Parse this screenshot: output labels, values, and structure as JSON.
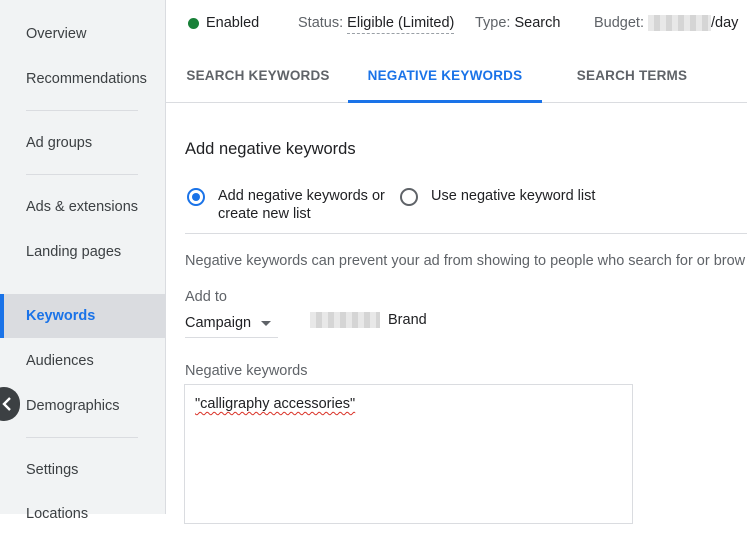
{
  "sidebar": {
    "items": [
      {
        "label": "Overview"
      },
      {
        "label": "Recommendations"
      },
      {
        "label": "Ad groups"
      },
      {
        "label": "Ads & extensions"
      },
      {
        "label": "Landing pages"
      },
      {
        "label": "Keywords",
        "active": true
      },
      {
        "label": "Audiences"
      },
      {
        "label": "Demographics"
      },
      {
        "label": "Settings"
      },
      {
        "label": "Locations"
      }
    ],
    "collapse_icon": "chevron-left-icon"
  },
  "status_bar": {
    "enabled": "Enabled",
    "status_label": "Status:",
    "status_value": "Eligible (Limited)",
    "type_label": "Type:",
    "type_value": "Search",
    "budget_label": "Budget:",
    "budget_suffix": "/day"
  },
  "tabs": [
    {
      "label": "SEARCH KEYWORDS"
    },
    {
      "label": "NEGATIVE KEYWORDS",
      "active": true
    },
    {
      "label": "SEARCH TERMS"
    }
  ],
  "form": {
    "title": "Add negative keywords",
    "radio_add_line1": "Add negative keywords or",
    "radio_add_line2": "create new list",
    "radio_list": "Use negative keyword list",
    "description": "Negative keywords can prevent your ad from showing to people who search for or brow",
    "add_to_label": "Add to",
    "add_to_value": "Campaign",
    "campaign_name_suffix": "Brand",
    "negative_keywords_label": "Negative keywords",
    "negative_keywords_value": "\"calligraphy accessories\""
  },
  "colors": {
    "accent": "#1a73e8",
    "enabled_dot": "#188038"
  }
}
